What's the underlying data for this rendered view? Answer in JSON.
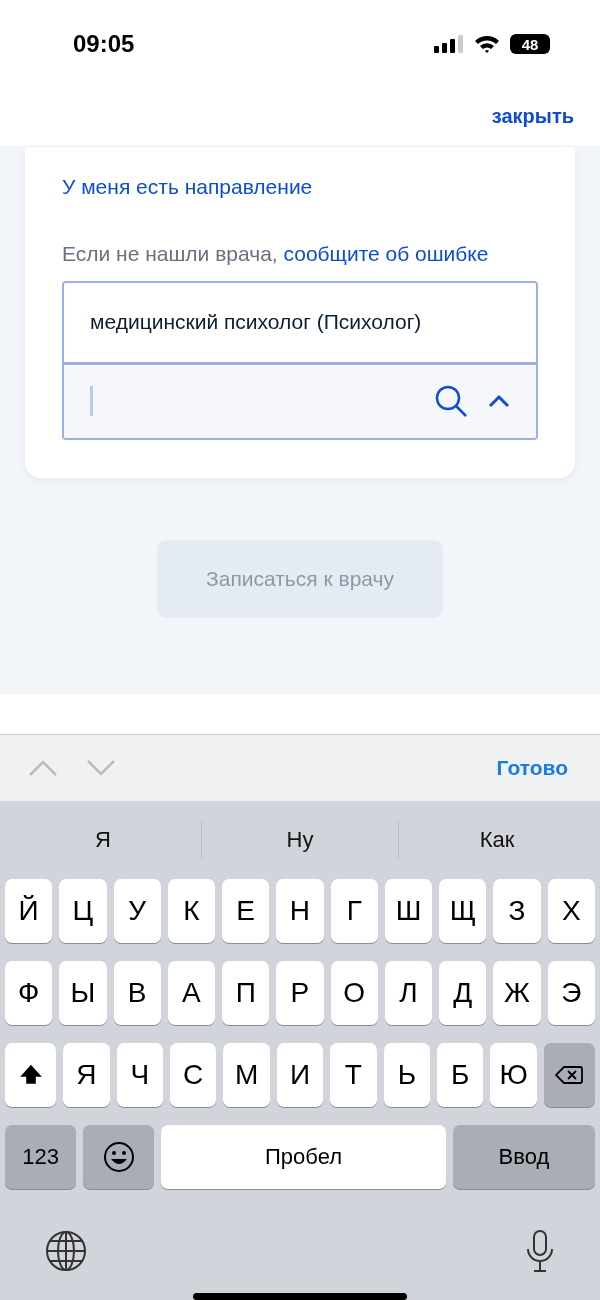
{
  "status_bar": {
    "time": "09:05",
    "battery": "48"
  },
  "header": {
    "close": "закрыть"
  },
  "card": {
    "referral_link": "У меня есть направление",
    "note": {
      "text": "Если не нашли врача,",
      "link": "сообщите об ошибке"
    },
    "dropdown": {
      "expanded": true,
      "options": [
        {
          "label": "медицинский психолог (Психолог)"
        }
      ]
    }
  },
  "submit": {
    "label": "Записаться к врачу",
    "disabled": true
  },
  "toolbar": {
    "prev_disabled": true,
    "next_disabled": true,
    "done": "Готово"
  },
  "keyboard": {
    "suggestions": [
      "Я",
      "Ну",
      "Как"
    ],
    "rows": [
      [
        {
          "kind": "letter",
          "label": "Й"
        },
        {
          "kind": "letter",
          "label": "Ц"
        },
        {
          "kind": "letter",
          "label": "У"
        },
        {
          "kind": "letter",
          "label": "К"
        },
        {
          "kind": "letter",
          "label": "Е"
        },
        {
          "kind": "letter",
          "label": "Н"
        },
        {
          "kind": "letter",
          "label": "Г"
        },
        {
          "kind": "letter",
          "label": "Ш"
        },
        {
          "kind": "letter",
          "label": "Щ"
        },
        {
          "kind": "letter",
          "label": "З"
        },
        {
          "kind": "letter",
          "label": "Х"
        }
      ],
      [
        {
          "kind": "letter",
          "label": "Ф"
        },
        {
          "kind": "letter",
          "label": "Ы"
        },
        {
          "kind": "letter",
          "label": "В"
        },
        {
          "kind": "letter",
          "label": "А"
        },
        {
          "kind": "letter",
          "label": "П"
        },
        {
          "kind": "letter",
          "label": "Р"
        },
        {
          "kind": "letter",
          "label": "О"
        },
        {
          "kind": "letter",
          "label": "Л"
        },
        {
          "kind": "letter",
          "label": "Д"
        },
        {
          "kind": "letter",
          "label": "Ж"
        },
        {
          "kind": "letter",
          "label": "Э"
        }
      ],
      [
        {
          "kind": "shift",
          "on": true
        },
        {
          "kind": "letter",
          "label": "Я"
        },
        {
          "kind": "letter",
          "label": "Ч"
        },
        {
          "kind": "letter",
          "label": "С"
        },
        {
          "kind": "letter",
          "label": "М"
        },
        {
          "kind": "letter",
          "label": "И"
        },
        {
          "kind": "letter",
          "label": "Т"
        },
        {
          "kind": "letter",
          "label": "Ь"
        },
        {
          "kind": "letter",
          "label": "Б"
        },
        {
          "kind": "letter",
          "label": "Ю"
        },
        {
          "kind": "backspace"
        }
      ]
    ],
    "numbers": "123",
    "space": "Пробел",
    "return": "Ввод"
  }
}
